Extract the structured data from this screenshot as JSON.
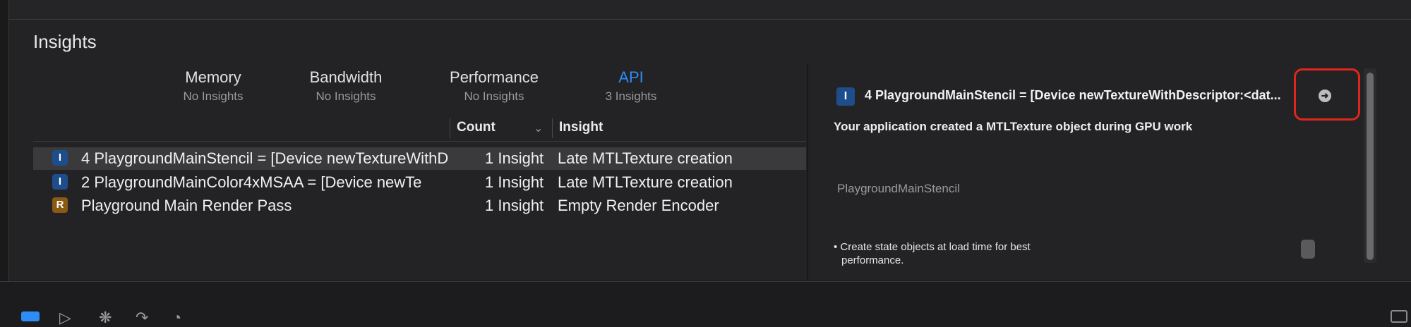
{
  "panel": {
    "title": "Insights"
  },
  "tabs": [
    {
      "label": "Memory",
      "sub": "No Insights"
    },
    {
      "label": "Bandwidth",
      "sub": "No Insights"
    },
    {
      "label": "Performance",
      "sub": "No Insights"
    },
    {
      "label": "API",
      "sub": "3 Insights"
    }
  ],
  "table": {
    "headers": {
      "count": "Count",
      "insight": "Insight"
    },
    "rows": [
      {
        "badge": "I",
        "name": "4 PlaygroundMainStencil = [Device newTextureWithDescriptor:<dat...",
        "count": "1 Insight",
        "insight": "Late MTLTexture creation"
      },
      {
        "badge": "I",
        "name": "2 PlaygroundMainColor4xMSAA = [Device newTe",
        "count": "1 Insight",
        "insight": "Late MTLTexture creation"
      },
      {
        "badge": "R",
        "name": "Playground Main Render Pass",
        "count": "1 Insight",
        "insight": "Empty Render Encoder"
      }
    ]
  },
  "detail": {
    "badge": "I",
    "title": "4 PlaygroundMainStencil = [Device newTextureWithDescriptor:<dat...",
    "description": "Your application created a MTLTexture object during GPU work",
    "object": "PlaygroundMainStencil",
    "bullet_line1": "• Create state objects at load time for best",
    "bullet_line2": "performance."
  },
  "colors": {
    "accent": "#2f8cf6",
    "highlight_ring": "#e0261c",
    "badge_i": "#1e4d8c",
    "badge_r": "#8a5a14"
  },
  "icons": [
    "chevron-down-icon",
    "arrow-right-circle-icon",
    "toolbar-play-icon",
    "toolbar-bug-icon",
    "toolbar-redo-icon",
    "toolbar-gauge-icon"
  ]
}
